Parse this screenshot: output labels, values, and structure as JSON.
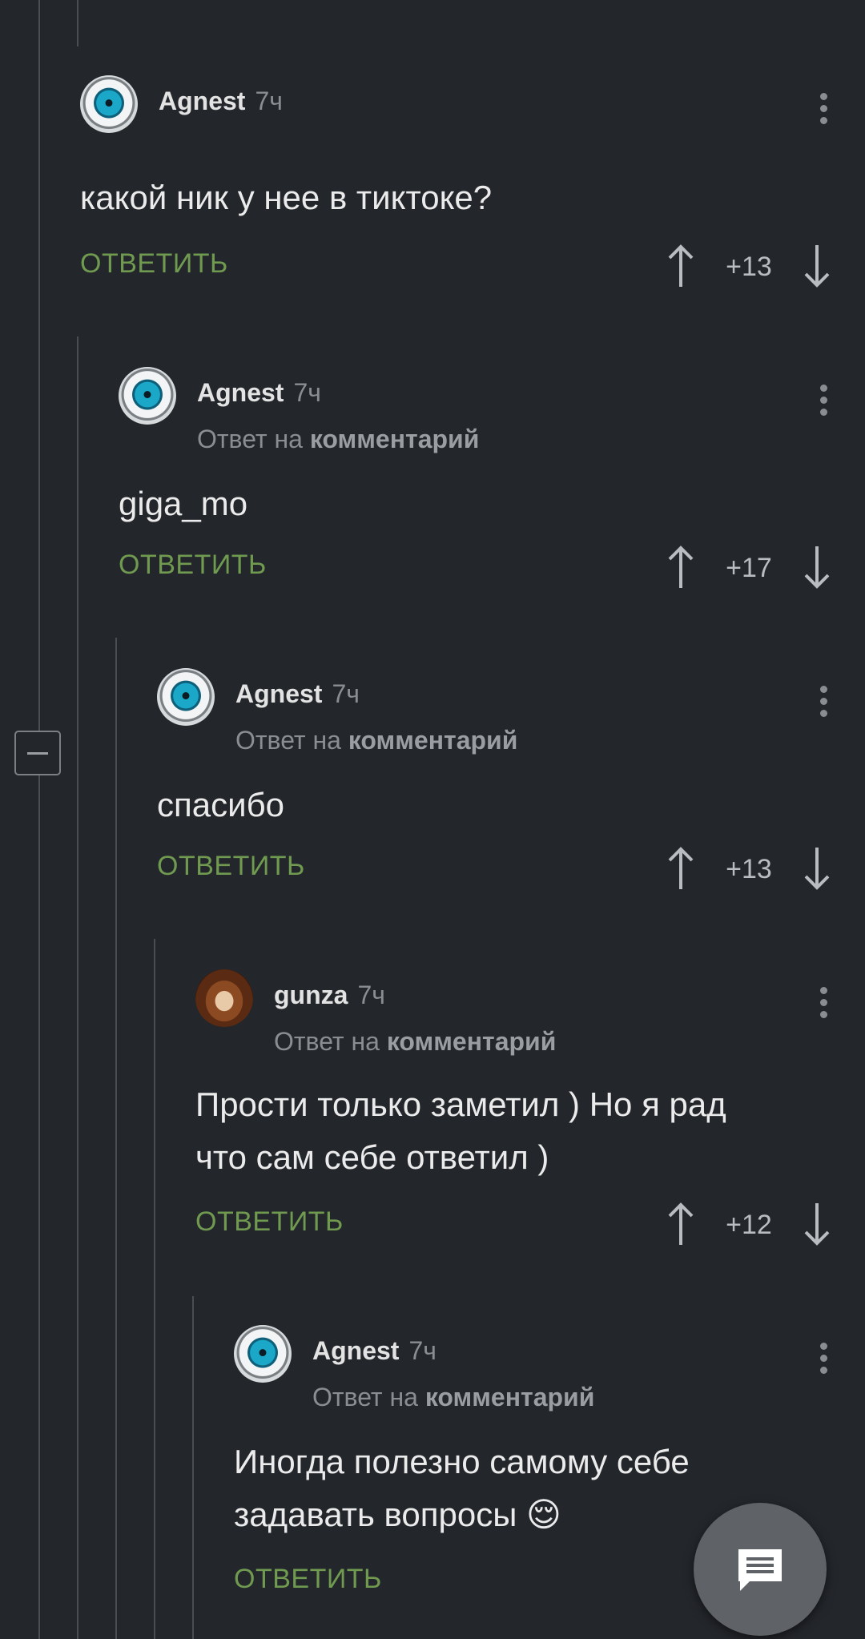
{
  "comments": [
    {
      "author": "Agnest",
      "time": "7ч",
      "reply_prefix": "",
      "reply_target": "",
      "text": "какой ник у нее в тиктоке?",
      "reply_label": "ОТВЕТИТЬ",
      "score": "+13",
      "avatar": "eye-avatar"
    },
    {
      "author": "Agnest",
      "time": "7ч",
      "reply_prefix": "Ответ на",
      "reply_target": "комментарий",
      "text": "giga_mo",
      "reply_label": "ОТВЕТИТЬ",
      "score": "+17",
      "avatar": "eye-avatar"
    },
    {
      "author": "Agnest",
      "time": "7ч",
      "reply_prefix": "Ответ на",
      "reply_target": "комментарий",
      "text": "спасибо",
      "reply_label": "ОТВЕТИТЬ",
      "score": "+13",
      "avatar": "eye-avatar"
    },
    {
      "author": "gunza",
      "time": "7ч",
      "reply_prefix": "Ответ на",
      "reply_target": "комментарий",
      "text": "Прости только заметил ) Но я рад\nчто сам себе ответил )",
      "reply_label": "ОТВЕТИТЬ",
      "score": "+12",
      "avatar": "monkey-avatar"
    },
    {
      "author": "Agnest",
      "time": "7ч",
      "reply_prefix": "Ответ на",
      "reply_target": "комментарий",
      "text": "Иногда полезно самому себе\nзадавать вопросы 😌",
      "reply_label": "ОТВЕТИТЬ",
      "score": "",
      "avatar": "eye-avatar"
    }
  ],
  "icons": {
    "upvote": "arrow-up-icon",
    "downvote": "arrow-down-icon",
    "menu": "more-vert-icon",
    "collapse": "minus-icon",
    "fab": "comment-icon"
  },
  "colors": {
    "background": "#23262b",
    "reply_button": "#6f9a4f",
    "muted": "#8a8d92"
  }
}
